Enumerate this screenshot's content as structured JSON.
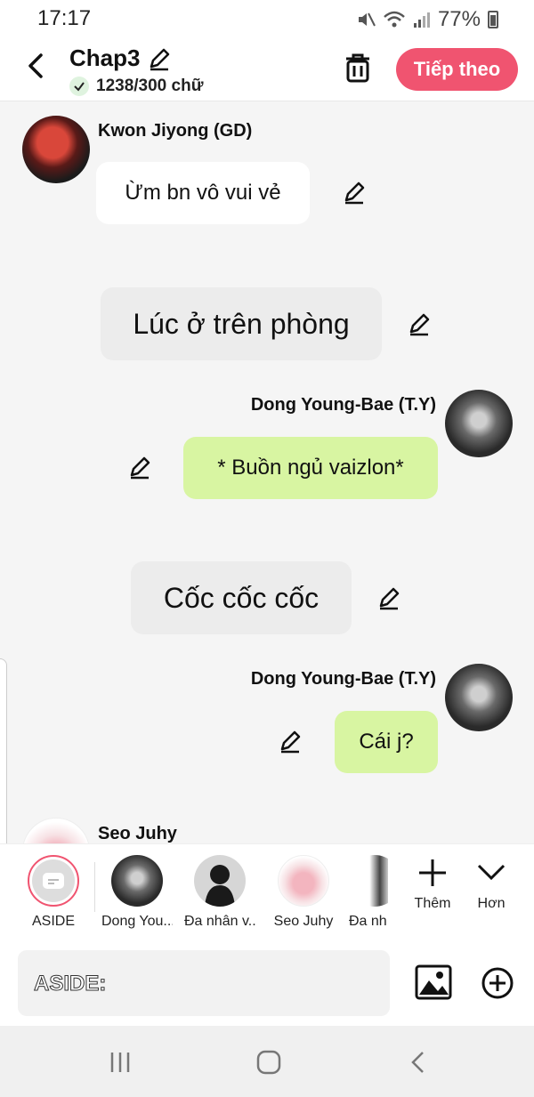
{
  "status": {
    "time": "17:17",
    "battery": "77%"
  },
  "header": {
    "title": "Chap3",
    "word_count": "1238/300 chữ",
    "next_label": "Tiếp theo"
  },
  "messages": [
    {
      "type": "left",
      "sender": "Kwon Jiyong (GD)",
      "text": "Ừm bn vô vui vẻ"
    },
    {
      "type": "narration",
      "text": "Lúc ở trên phòng"
    },
    {
      "type": "right",
      "sender": "Dong Young-Bae (T.Y)",
      "text": "* Buồn ngủ vaizlon*"
    },
    {
      "type": "narration",
      "text": "Cốc cốc cốc"
    },
    {
      "type": "right",
      "sender": "Dong Young-Bae (T.Y)",
      "text": "Cái j?"
    },
    {
      "type": "left",
      "sender": "Seo Juhy",
      "text": ""
    }
  ],
  "characters": [
    {
      "label": "ASIDE"
    },
    {
      "label": "Dong You..."
    },
    {
      "label": "Đa nhân v..."
    },
    {
      "label": "Seo Juhy"
    },
    {
      "label": "Đa nh"
    }
  ],
  "tools": {
    "add_label": "Thêm",
    "more_label": "Hơn"
  },
  "input": {
    "placeholder": "ASIDE:"
  },
  "colors": {
    "accent": "#f05470",
    "right_bubble": "#d8f5a2",
    "narration_bubble": "#ececec"
  }
}
